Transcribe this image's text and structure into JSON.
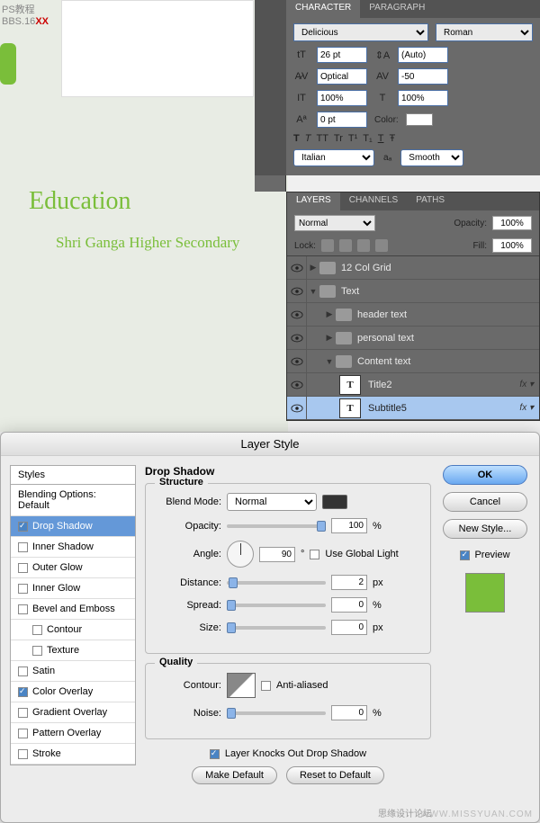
{
  "watermark": {
    "line1": "PS教程",
    "line2_prefix": "BBS.16",
    "line2_red": "XX"
  },
  "canvas": {
    "title": "Education",
    "subtitle": "Shri Ganga Higher Secondary"
  },
  "character": {
    "tabs": [
      "CHARACTER",
      "PARAGRAPH"
    ],
    "font_family": "Delicious",
    "font_style": "Roman",
    "size": "26 pt",
    "leading": "(Auto)",
    "kerning": "Optical",
    "tracking": "-50",
    "vscale": "100%",
    "hscale": "100%",
    "baseline": "0 pt",
    "color_label": "Color:",
    "type_buttons": [
      "T",
      "T",
      "TT",
      "Tr",
      "T¹",
      "T₁",
      "T",
      "Ŧ"
    ],
    "language": "Italian",
    "aa_label": "aₐ",
    "aa_method": "Smooth"
  },
  "layers": {
    "tabs": [
      "LAYERS",
      "CHANNELS",
      "PATHS"
    ],
    "blend_mode": "Normal",
    "opacity_label": "Opacity:",
    "opacity": "100%",
    "lock_label": "Lock:",
    "fill_label": "Fill:",
    "fill": "100%",
    "items": [
      {
        "name": "12 Col Grid",
        "type": "group",
        "expanded": false,
        "indent": 0,
        "eye": true
      },
      {
        "name": "Text",
        "type": "group",
        "expanded": true,
        "indent": 0,
        "eye": true
      },
      {
        "name": "header text",
        "type": "group",
        "expanded": false,
        "indent": 1,
        "eye": true
      },
      {
        "name": "personal text",
        "type": "group",
        "expanded": false,
        "indent": 1,
        "eye": true
      },
      {
        "name": "Content text",
        "type": "group",
        "expanded": true,
        "indent": 1,
        "eye": true
      },
      {
        "name": "Title2",
        "type": "text",
        "indent": 2,
        "eye": true,
        "fx": true
      },
      {
        "name": "Subtitle5",
        "type": "text",
        "indent": 2,
        "eye": true,
        "fx": true,
        "selected": true
      }
    ]
  },
  "dialog": {
    "title": "Layer Style",
    "styles_header": "Styles",
    "blending_default": "Blending Options: Default",
    "style_items": [
      {
        "label": "Drop Shadow",
        "checked": true,
        "selected": true
      },
      {
        "label": "Inner Shadow",
        "checked": false
      },
      {
        "label": "Outer Glow",
        "checked": false
      },
      {
        "label": "Inner Glow",
        "checked": false
      },
      {
        "label": "Bevel and Emboss",
        "checked": false
      },
      {
        "label": "Contour",
        "checked": false,
        "sub": true
      },
      {
        "label": "Texture",
        "checked": false,
        "sub": true
      },
      {
        "label": "Satin",
        "checked": false
      },
      {
        "label": "Color Overlay",
        "checked": true
      },
      {
        "label": "Gradient Overlay",
        "checked": false
      },
      {
        "label": "Pattern Overlay",
        "checked": false
      },
      {
        "label": "Stroke",
        "checked": false
      }
    ],
    "section_title": "Drop Shadow",
    "structure": {
      "legend": "Structure",
      "blend_mode_label": "Blend Mode:",
      "blend_mode": "Normal",
      "opacity_label": "Opacity:",
      "opacity": "100",
      "opacity_unit": "%",
      "angle_label": "Angle:",
      "angle": "90",
      "angle_unit": "°",
      "global_light": "Use Global Light",
      "distance_label": "Distance:",
      "distance": "2",
      "spread_label": "Spread:",
      "spread": "0",
      "size_label": "Size:",
      "size": "0",
      "px": "px",
      "pct": "%"
    },
    "quality": {
      "legend": "Quality",
      "contour_label": "Contour:",
      "anti_aliased": "Anti-aliased",
      "noise_label": "Noise:",
      "noise": "0",
      "pct": "%"
    },
    "knockout": "Layer Knocks Out Drop Shadow",
    "make_default": "Make Default",
    "reset_default": "Reset to Default",
    "buttons": {
      "ok": "OK",
      "cancel": "Cancel",
      "new_style": "New Style...",
      "preview": "Preview"
    }
  },
  "footer": {
    "cn": "思缘设计论坛",
    "url": "WWW.MISSYUAN.COM"
  }
}
